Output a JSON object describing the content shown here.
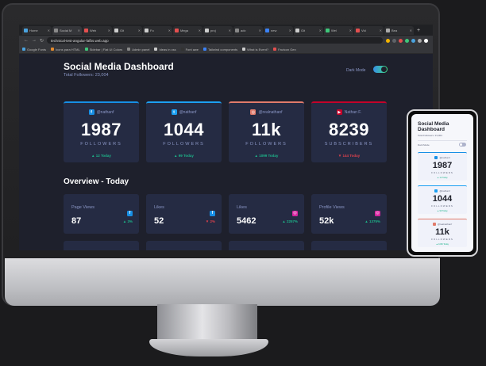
{
  "browser": {
    "tabs": [
      {
        "title": "Home",
        "color": "#4aa3df"
      },
      {
        "title": "Social M",
        "color": "#8a8a8a"
      },
      {
        "title": "Web",
        "color": "#e34f4f"
      },
      {
        "title": "Git",
        "color": "#cccccc"
      },
      {
        "title": "Fo",
        "color": "#cccccc"
      },
      {
        "title": "Mega",
        "color": "#e34f4f"
      },
      {
        "title": "proj",
        "color": "#cccccc"
      },
      {
        "title": "adv",
        "color": "#888888"
      },
      {
        "title": "new",
        "color": "#3b82f6"
      },
      {
        "title": "Git",
        "color": "#cccccc"
      },
      {
        "title": "Wel",
        "color": "#3ec77a"
      },
      {
        "title": "Vid",
        "color": "#e34f4f"
      },
      {
        "title": "Bea",
        "color": "#aaaaaa"
      }
    ],
    "new_tab": "+",
    "url": "technical-test-angular-fafbs.web.app",
    "extension_colors": [
      "#f4b400",
      "#5f6368",
      "#e34f4f",
      "#3ec77a",
      "#4aa3df",
      "#aaaaaa",
      "#ffffff"
    ],
    "bookmarks": [
      {
        "label": "Google Fonts",
        "color": "#4aa3df"
      },
      {
        "label": "Icons para HTML",
        "color": "#e38a2e"
      },
      {
        "label": "Sidebar | Flat UI Colors",
        "color": "#3ec77a"
      },
      {
        "label": "Admin panel",
        "color": "#888888"
      },
      {
        "label": "Ideas in css",
        "color": "#cccccc"
      },
      {
        "label": "Font awe",
        "color": "#333333"
      },
      {
        "label": "Tailwind components",
        "color": "#3b82f6"
      },
      {
        "label": "What is Event?",
        "color": "#cccccc"
      },
      {
        "label": "Favicon Gen",
        "color": "#e34f4f"
      }
    ]
  },
  "dashboard": {
    "title": "Social Media Dashboard",
    "subtitle": "Total Followers: 23,004",
    "mode_label": "Dark Mode",
    "cards": [
      {
        "network": "facebook",
        "handle": "@nathanf",
        "count": "1987",
        "label": "FOLLOWERS",
        "change": "▲ 12 Today",
        "trend": "up",
        "accent": "#178fe5",
        "icon_char": "f"
      },
      {
        "network": "twitter",
        "handle": "@nathanf",
        "count": "1044",
        "label": "FOLLOWERS",
        "change": "▲ 99 Today",
        "trend": "up",
        "accent": "#1ca0f2",
        "icon_char": "t"
      },
      {
        "network": "instagram",
        "handle": "@realnathanf",
        "count": "11k",
        "label": "FOLLOWERS",
        "change": "▲ 1099 Today",
        "trend": "up",
        "accent": "#e17b6b",
        "icon_char": "◎"
      },
      {
        "network": "youtube",
        "handle": "Nathan F.",
        "count": "8239",
        "label": "SUBSCRIBERS",
        "change": "▼ 144 Today",
        "trend": "down",
        "accent": "#c4032a",
        "icon_char": "▶"
      }
    ],
    "overview_title": "Overview - Today",
    "overview": [
      {
        "label": "Page Views",
        "value": "87",
        "pct": "▲ 3%",
        "trend": "up",
        "network": "facebook",
        "icon_color": "#178fe5",
        "icon_char": "f"
      },
      {
        "label": "Likes",
        "value": "52",
        "pct": "▼ 2%",
        "trend": "down",
        "network": "facebook",
        "icon_color": "#178fe5",
        "icon_char": "f"
      },
      {
        "label": "Likes",
        "value": "5462",
        "pct": "▲ 2257%",
        "trend": "up",
        "network": "instagram",
        "icon_color": "#d6249f",
        "icon_char": "◎"
      },
      {
        "label": "Profile Views",
        "value": "52k",
        "pct": "▲ 1375%",
        "trend": "up",
        "network": "instagram",
        "icon_color": "#d6249f",
        "icon_char": "◎"
      }
    ]
  },
  "phone": {
    "title": "Social Media Dashboard",
    "subtitle": "Total Followers: 23,004",
    "mode_label": "Dark Mode",
    "cards": [
      {
        "handle": "@nathanf",
        "count": "1987",
        "label": "FOLLOWERS",
        "change": "▲ 12 Today",
        "accent": "#178fe5"
      },
      {
        "handle": "@nathanf",
        "count": "1044",
        "label": "FOLLOWERS",
        "change": "▲ 99 Today",
        "accent": "#1ca0f2"
      },
      {
        "handle": "@realnathanf",
        "count": "11k",
        "label": "FOLLOWERS",
        "change": "▲ 1099 Today",
        "accent": "#e17b6b"
      }
    ]
  }
}
